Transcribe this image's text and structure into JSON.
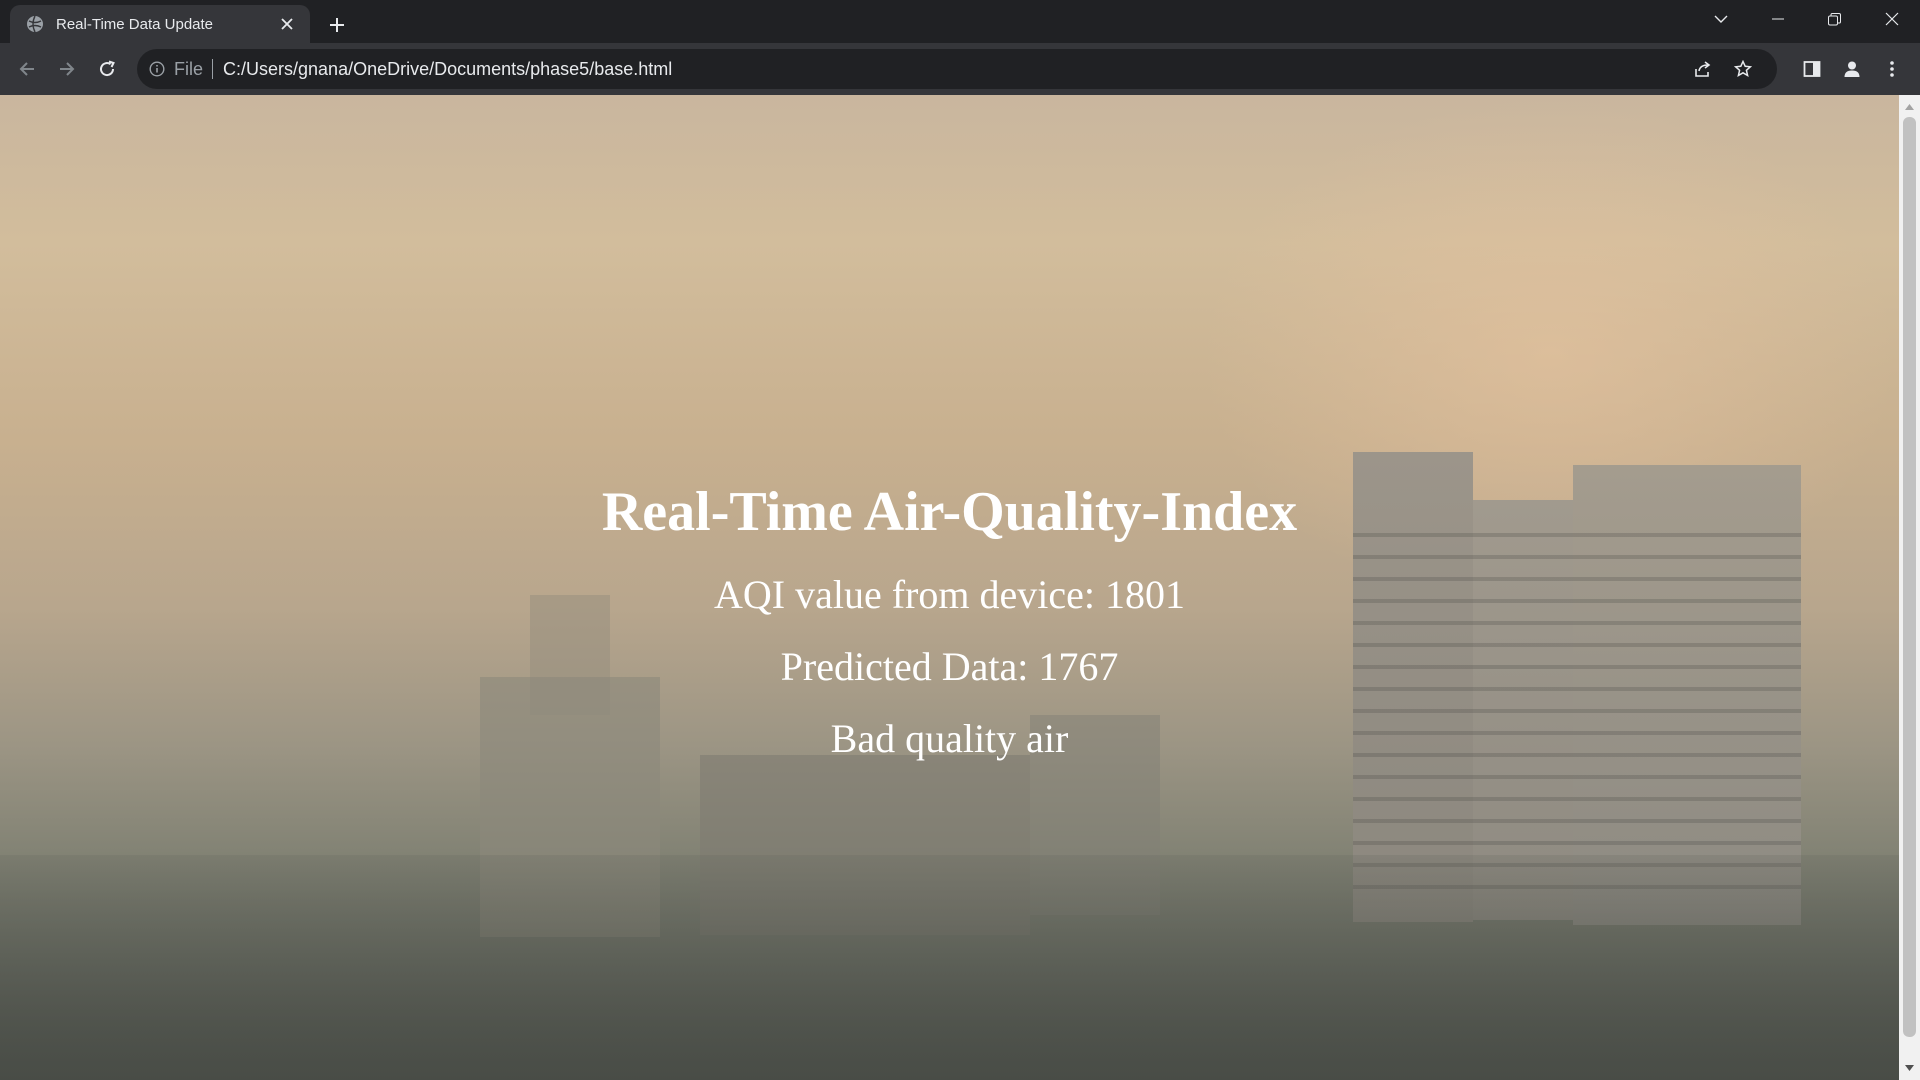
{
  "browser": {
    "tab": {
      "title": "Real-Time Data Update",
      "favicon": "globe-icon"
    },
    "omnibox": {
      "scheme_label": "File",
      "url": "C:/Users/gnana/OneDrive/Documents/phase5/base.html"
    }
  },
  "page": {
    "title": "Real-Time Air-Quality-Index",
    "aqi_line": "AQI value from device: 1801",
    "predicted_line": "Predicted Data: 1767",
    "status_line": "Bad quality air"
  },
  "colors": {
    "chrome_dark": "#202124",
    "chrome_toolbar": "#35363a",
    "text_light": "#e8eaed",
    "page_text": "#ffffff"
  }
}
